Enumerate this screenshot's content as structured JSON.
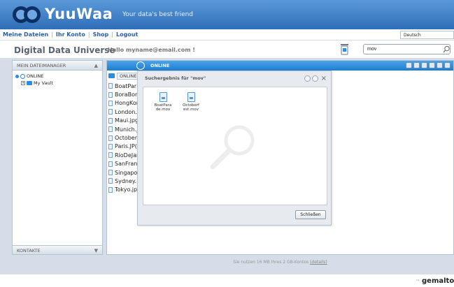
{
  "header": {
    "brand": "YuuWaa",
    "tagline": "Your data's best friend"
  },
  "nav": {
    "items": [
      "Meine Dateien",
      "Ihr Konto",
      "Shop",
      "Logout"
    ],
    "language": "Deutsch"
  },
  "titlebar": {
    "app_title": "Digital Data Universe",
    "greeting": "Hallo myname@email.com !",
    "search_value": "mov"
  },
  "left_panel": {
    "header": "MEIN DATEIMANAGER",
    "tree": {
      "root": "ONLINE",
      "child": "My Vault"
    },
    "footer": "KONTAKTE"
  },
  "right_panel": {
    "header": "ONLINE",
    "breadcrumb": "ONLINE",
    "files": [
      "BoatPar",
      "BoraBor",
      "HongKor",
      "London.",
      "Maui.jpg",
      "Munich.j",
      "October",
      "Paris.JP(",
      "RioDeJar",
      "SanFran",
      "Singapo",
      "Sydney.",
      "Tokyo.jp"
    ]
  },
  "dialog": {
    "title": "Suchergebnis für \"mov\"",
    "results": [
      "BoatPara de.mov",
      "Octoberf est.mov"
    ],
    "close_label": "Schließen"
  },
  "footer": {
    "usage_text": "Sie nutzen 16 MB Ihres 2 GB-Kontos",
    "details_link": "(details)",
    "brand": "gemalto"
  },
  "colors": {
    "header_blue": "#2f6fb8",
    "accent_blue": "#1e7dd0",
    "nav_link": "#2a5ea8"
  }
}
